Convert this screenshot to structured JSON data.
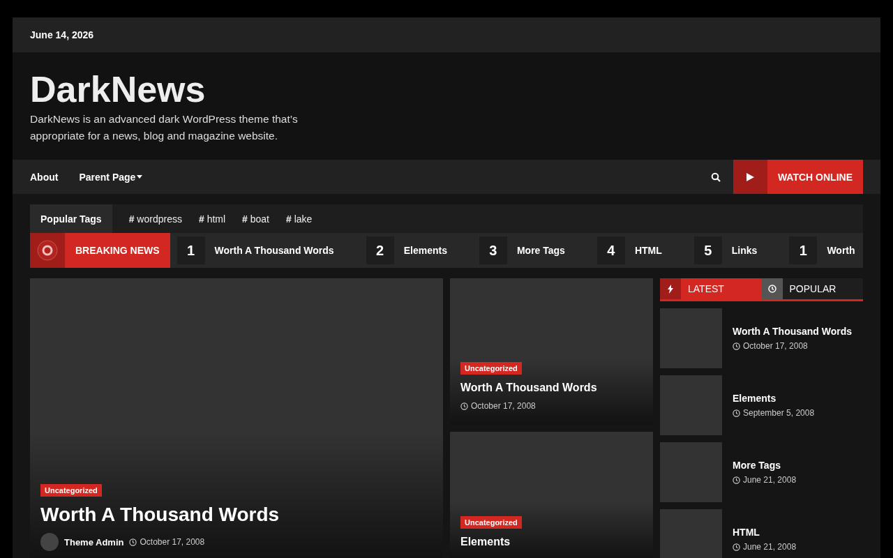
{
  "top_bar": {
    "date": "June 14, 2026"
  },
  "site": {
    "title": "DarkNews",
    "tagline": "DarkNews is an advanced dark WordPress theme that’s appropriate for a news, blog and magazine website."
  },
  "nav": {
    "items": [
      {
        "label": "About",
        "has_dropdown": false
      },
      {
        "label": "Parent Page",
        "has_dropdown": true
      }
    ],
    "watch_button": "WATCH ONLINE"
  },
  "popular_tags": {
    "label": "Popular Tags",
    "tags": [
      {
        "marker": "#",
        "name": "wordpress"
      },
      {
        "marker": "#",
        "name": "html"
      },
      {
        "marker": "#",
        "name": "boat"
      },
      {
        "marker": "#",
        "name": "lake"
      }
    ]
  },
  "breaking_news": {
    "label": "BREAKING NEWS",
    "items": [
      {
        "number": "1",
        "title": "Worth A Thousand Words"
      },
      {
        "number": "2",
        "title": "Elements"
      },
      {
        "number": "3",
        "title": "More Tags"
      },
      {
        "number": "4",
        "title": "HTML"
      },
      {
        "number": "5",
        "title": "Links"
      },
      {
        "number": "1",
        "title": "Worth"
      }
    ]
  },
  "featured": {
    "category": "Uncategorized",
    "title": "Worth A Thousand Words",
    "author": "Theme Admin",
    "date": "October 17, 2008"
  },
  "middle_posts": [
    {
      "category": "Uncategorized",
      "title": "Worth A Thousand Words",
      "date": "October 17, 2008"
    },
    {
      "category": "Uncategorized",
      "title": "Elements"
    }
  ],
  "sidebar": {
    "tabs": [
      {
        "label": "LATEST",
        "kind": "bolt",
        "selected": true
      },
      {
        "label": "POPULAR",
        "kind": "clock",
        "selected": false
      }
    ],
    "posts": [
      {
        "title": "Worth A Thousand Words",
        "date": "October 17, 2008"
      },
      {
        "title": "Elements",
        "date": "September 5, 2008"
      },
      {
        "title": "More Tags",
        "date": "June 21, 2008"
      },
      {
        "title": "HTML",
        "date": "June 21, 2008"
      }
    ]
  }
}
